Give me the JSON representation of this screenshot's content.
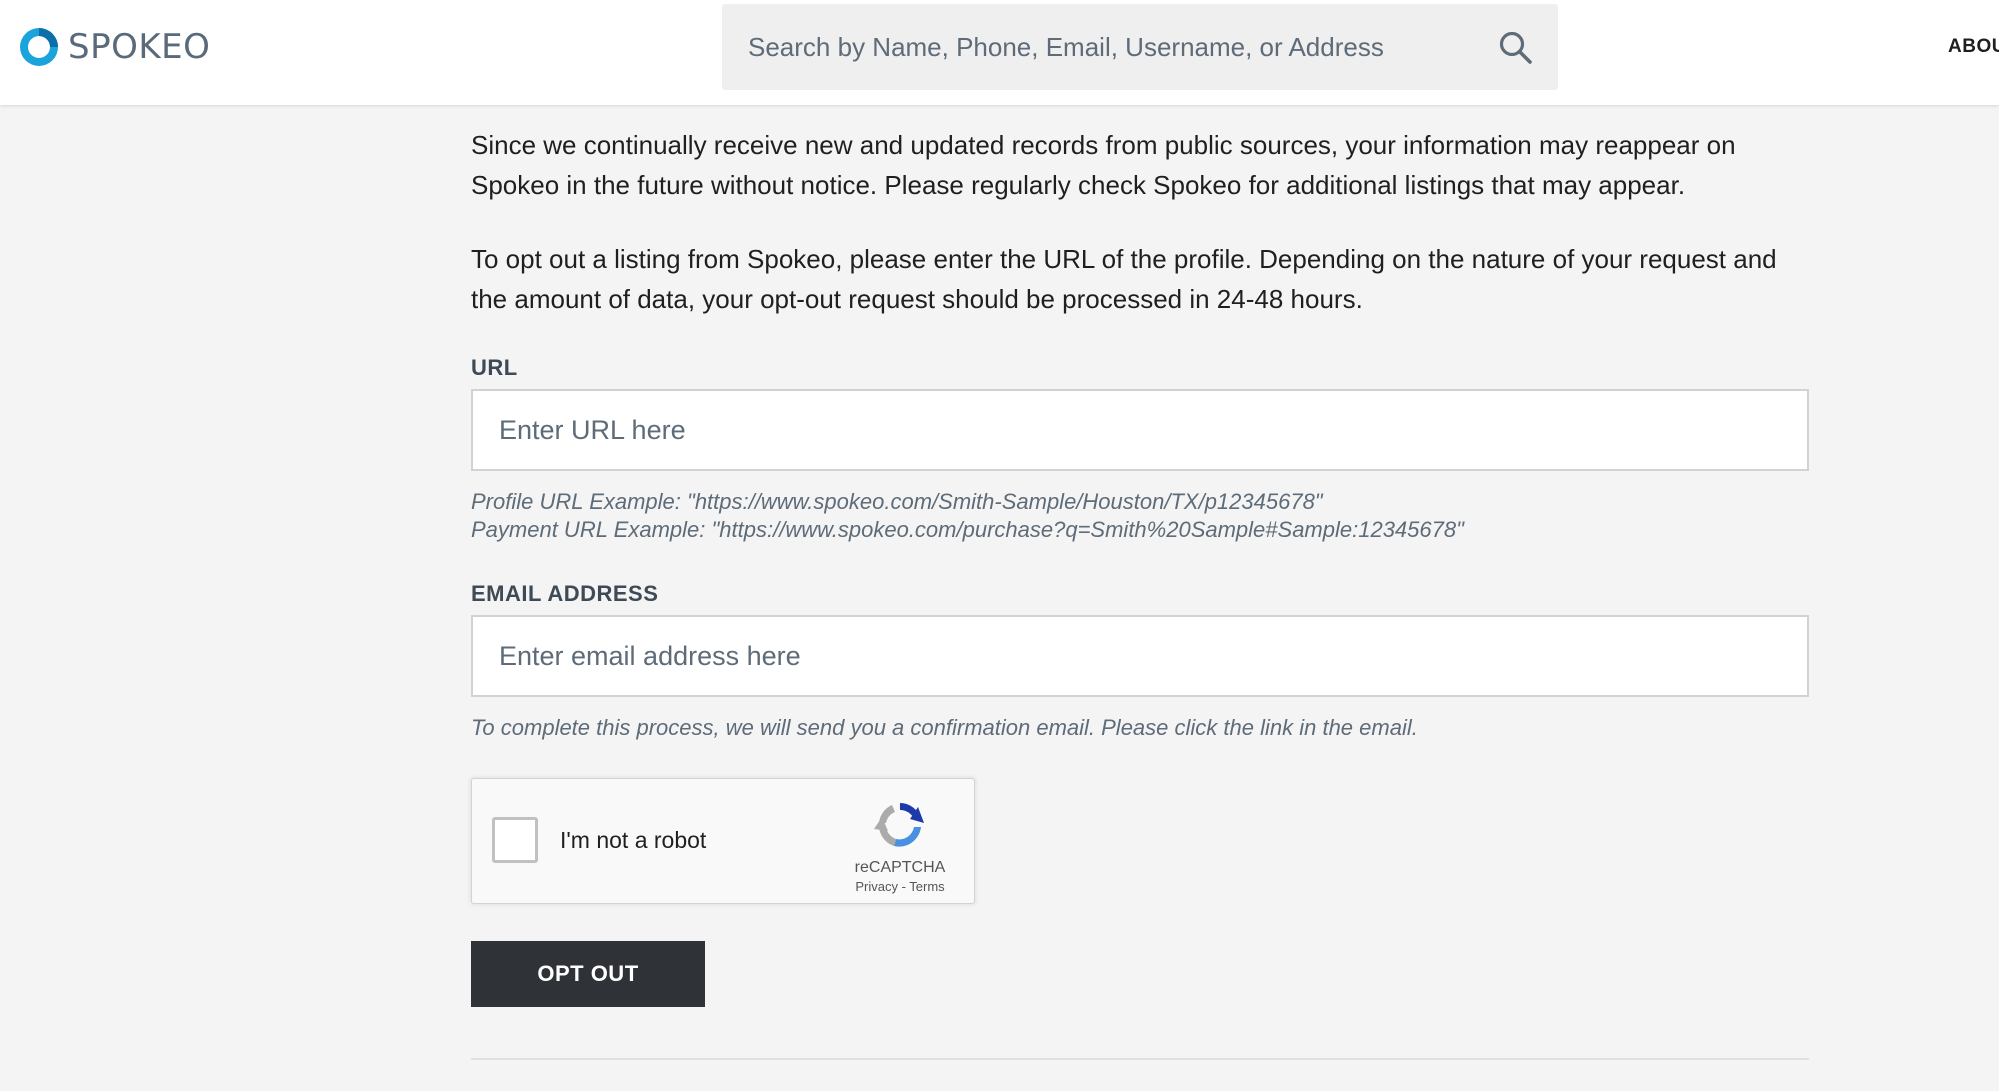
{
  "header": {
    "logo_text": "SPOKEO",
    "search_placeholder": "Search by Name, Phone, Email, Username, or Address",
    "nav_about": "ABOUT",
    "brand_color": "#1aa3dc"
  },
  "main": {
    "paragraph_1": "Since we continually receive new and updated records from public sources, your information may reappear on Spokeo in the future without notice. Please regularly check Spokeo for additional listings that may appear.",
    "paragraph_2": "To opt out a listing from Spokeo, please enter the URL of the profile. Depending on the nature of your request and the amount of data, your opt-out request should be processed in 24-48 hours.",
    "url_label": "URL",
    "url_placeholder": "Enter URL here",
    "url_hint_profile": "Profile URL Example: \"https://www.spokeo.com/Smith-Sample/Houston/TX/p12345678\"",
    "url_hint_payment": "Payment URL Example: \"https://www.spokeo.com/purchase?q=Smith%20Sample#Sample:12345678\"",
    "email_label": "EMAIL ADDRESS",
    "email_placeholder": "Enter email address here",
    "email_hint": "To complete this process, we will send you a confirmation email. Please click the link in the email.",
    "recaptcha": {
      "label": "I'm not a robot",
      "brand": "reCAPTCHA",
      "privacy": "Privacy",
      "separator": " - ",
      "terms": "Terms"
    },
    "optout_button": "OPT OUT",
    "button_color": "#2f3337"
  }
}
